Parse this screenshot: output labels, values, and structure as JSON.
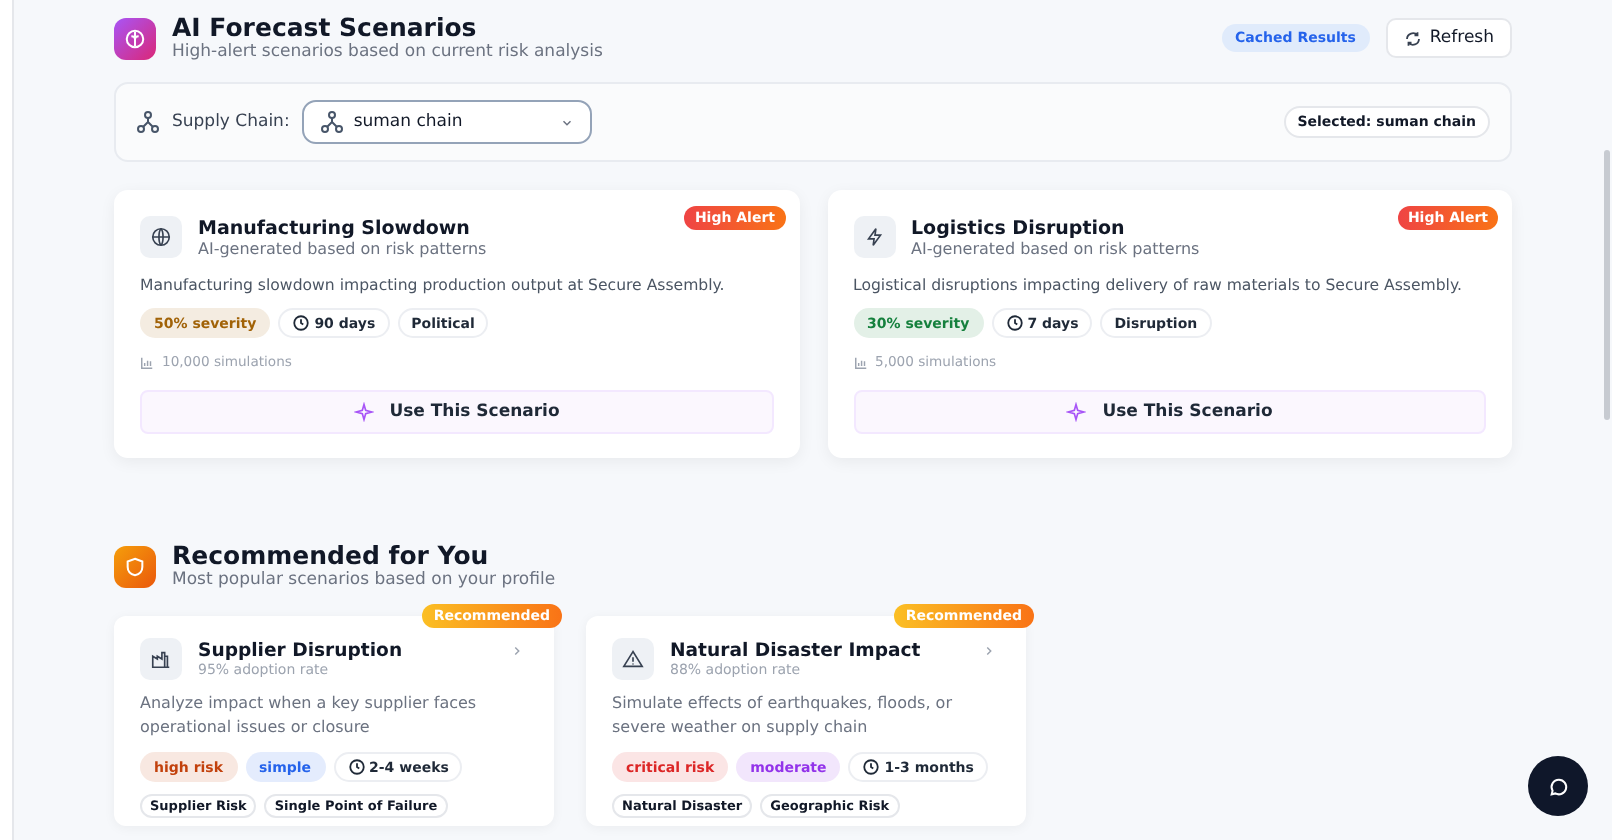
{
  "header": {
    "title": "AI Forecast Scenarios",
    "subtitle": "High-alert scenarios based on current risk analysis",
    "cache_badge": "Cached Results",
    "refresh_button": "Refresh"
  },
  "supply_chain": {
    "label": "Supply Chain:",
    "value": "suman chain",
    "selected_badge": "Selected: suman chain"
  },
  "forecast_cards": [
    {
      "title": "Manufacturing Slowdown",
      "subtitle": "AI-generated based on risk patterns",
      "badge": "High Alert",
      "description": "Manufacturing slowdown impacting production output at Secure Assembly.",
      "tags": [
        {
          "kind": "severity",
          "label": "50% severity",
          "color": "#a16207"
        },
        {
          "kind": "duration",
          "label": "90 days"
        },
        {
          "kind": "plain",
          "label": "Political"
        }
      ],
      "simulations": "10,000 simulations",
      "button": "Use This Scenario"
    },
    {
      "title": "Logistics Disruption",
      "subtitle": "AI-generated based on risk patterns",
      "badge": "High Alert",
      "description": "Logistical disruptions impacting delivery of raw materials to Secure Assembly.",
      "tags": [
        {
          "kind": "severity",
          "label": "30% severity",
          "color": "#15803d"
        },
        {
          "kind": "duration",
          "label": "7 days"
        },
        {
          "kind": "plain",
          "label": "Disruption"
        }
      ],
      "simulations": "5,000 simulations",
      "button": "Use This Scenario"
    }
  ],
  "recommended": {
    "title": "Recommended for You",
    "subtitle": "Most popular scenarios based on your profile",
    "cards": [
      {
        "badge": "Recommended",
        "title": "Supplier Disruption",
        "adoption": "95% adoption rate",
        "description": "Analyze impact when a key supplier faces operational issues or closure",
        "tags": [
          {
            "kind": "risk",
            "label": "high risk",
            "color": "#c2410c"
          },
          {
            "kind": "risk",
            "label": "simple",
            "color": "#2563eb"
          },
          {
            "kind": "duration",
            "label": "2-4 weeks"
          }
        ],
        "topics": [
          "Supplier Risk",
          "Single Point of Failure"
        ]
      },
      {
        "badge": "Recommended",
        "title": "Natural Disaster Impact",
        "adoption": "88% adoption rate",
        "description": "Simulate effects of earthquakes, floods, or severe weather on supply chain",
        "tags": [
          {
            "kind": "risk",
            "label": "critical risk",
            "color": "#dc2626"
          },
          {
            "kind": "risk",
            "label": "moderate",
            "color": "#9333ea"
          },
          {
            "kind": "duration",
            "label": "1-3 months"
          }
        ],
        "topics": [
          "Natural Disaster",
          "Geographic Risk"
        ]
      }
    ]
  }
}
